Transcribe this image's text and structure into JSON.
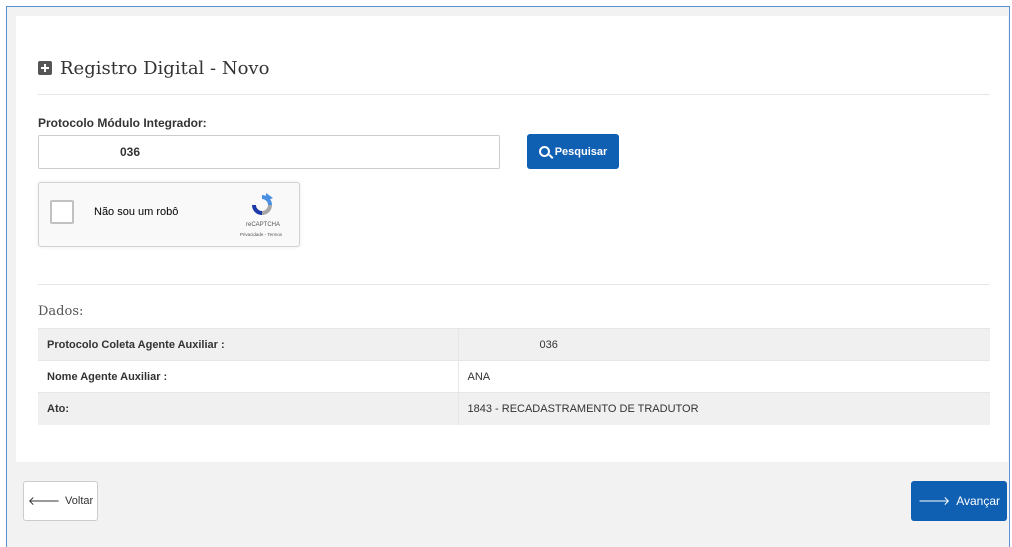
{
  "page": {
    "title": "Registro Digital - Novo"
  },
  "search": {
    "label": "Protocolo Módulo Integrador:",
    "value": "036",
    "button_label": "Pesquisar"
  },
  "captcha": {
    "label": "Não sou um robô",
    "brand": "reCAPTCHA",
    "terms": "Privacidade - Termos"
  },
  "dados": {
    "title": "Dados:",
    "rows": [
      {
        "key": "Protocolo Coleta Agente Auxiliar :",
        "value": "036"
      },
      {
        "key": "Nome Agente Auxiliar :",
        "value": "ANA"
      },
      {
        "key": "Ato:",
        "value": "1843 - RECADASTRAMENTO DE TRADUTOR"
      }
    ]
  },
  "footer": {
    "back_label": "Voltar",
    "next_label": "Avançar"
  },
  "colors": {
    "primary": "#0f5fb3",
    "frame_border": "#5b8fd6",
    "background": "#f2f2f2"
  },
  "icons": {
    "title": "plus-square-icon",
    "search": "search-icon",
    "back": "arrow-left-icon",
    "next": "arrow-right-icon",
    "captcha": "recaptcha-icon"
  }
}
